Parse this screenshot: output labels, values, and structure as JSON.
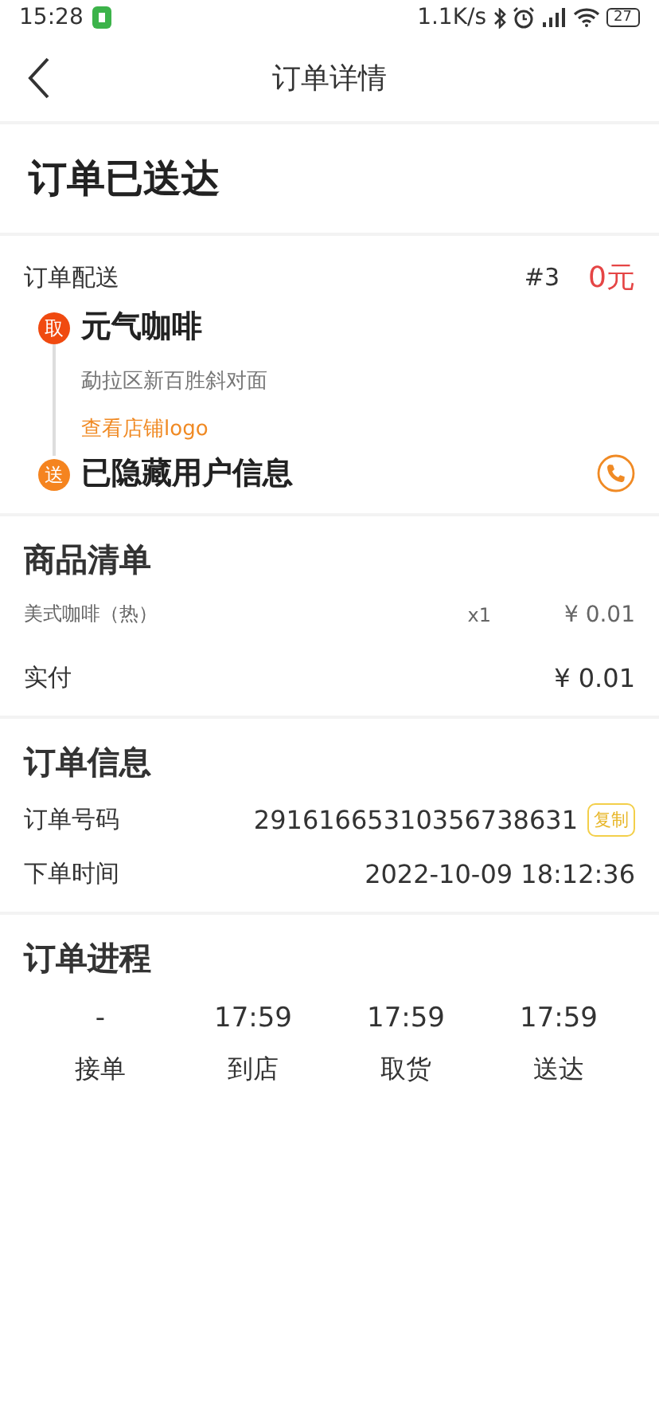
{
  "status_bar": {
    "time": "15:28",
    "speed": "1.1K/s",
    "battery": "27"
  },
  "nav": {
    "title": "订单详情"
  },
  "order_status": "订单已送达",
  "delivery": {
    "label": "订单配送",
    "number": "#3",
    "fee": "0元",
    "stops": [
      {
        "kind": "pickup",
        "badge": "取",
        "color": "#f04a10",
        "name": "元气咖啡",
        "address": "勐拉区新百胜斜对面",
        "link": "查看店铺logo"
      },
      {
        "kind": "deliver",
        "badge": "送",
        "color": "#f5841f",
        "name": "已隐藏用户信息"
      }
    ]
  },
  "goods": {
    "title": "商品清单",
    "items": [
      {
        "name": "美式咖啡（热）",
        "qty": "x1",
        "price": "¥ 0.01"
      }
    ],
    "paid_label": "实付",
    "paid": "¥ 0.01"
  },
  "info": {
    "title": "订单信息",
    "rows": [
      {
        "label": "订单号码",
        "value": "29161665310356738631",
        "copy": "复制"
      },
      {
        "label": "下单时间",
        "value": "2022-10-09 18:12:36"
      }
    ]
  },
  "progress": {
    "title": "订单进程",
    "steps": [
      {
        "time": "-",
        "label": "接单"
      },
      {
        "time": "17:59",
        "label": "到店"
      },
      {
        "time": "17:59",
        "label": "取货"
      },
      {
        "time": "17:59",
        "label": "送达"
      }
    ]
  }
}
